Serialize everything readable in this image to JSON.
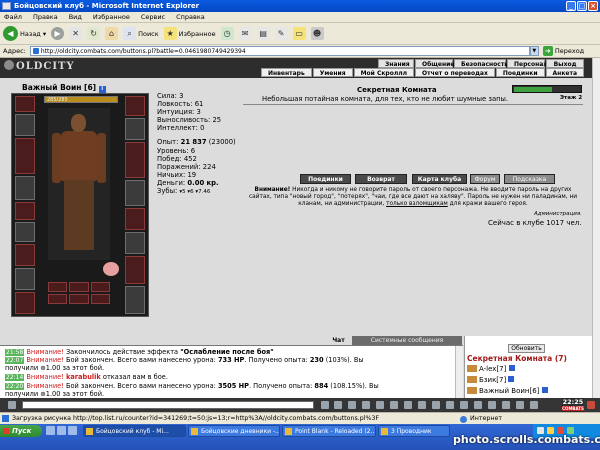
{
  "window": {
    "title": "Бойцовский клуб - Microsoft Internet Explorer"
  },
  "menu": [
    "Файл",
    "Правка",
    "Вид",
    "Избранное",
    "Сервис",
    "Справка"
  ],
  "toolbar": {
    "back": "Назад",
    "search": "Поиск",
    "favorites": "Избранное"
  },
  "address": {
    "label": "Адрес:",
    "url": "http://oldcity.combats.com/buttons.pl?battle=0.0461980749429394",
    "go": "Переход"
  },
  "game_nav": {
    "logo": "OLDCITY",
    "row1": [
      "Знания",
      "Общение",
      "Безопасность",
      "Персонаж",
      "Выход"
    ],
    "row2": [
      "Инвентарь",
      "Умения",
      "Мой Скроллл",
      "Отчет о переводах",
      "Поединки",
      "Анкета"
    ]
  },
  "character": {
    "name": "Важный Воин",
    "level": "[6]",
    "hp": "285/285",
    "hp_fraction": 1,
    "stats": [
      {
        "label": "Сила:",
        "value": "3"
      },
      {
        "label": "Ловкость:",
        "value": "61"
      },
      {
        "label": "Интуиция:",
        "value": "3"
      },
      {
        "label": "Выносливость:",
        "value": "25"
      },
      {
        "label": "Интеллект:",
        "value": "0"
      }
    ],
    "experience_label": "Опыт:",
    "experience": "21 837",
    "experience_next": "(23000)",
    "level_label": "Уровень:",
    "level_value": "6",
    "wins_label": "Побед:",
    "wins": "452",
    "losses_label": "Поражений:",
    "losses": "224",
    "draws_label": "Ничьих:",
    "draws": "19",
    "money_label": "Деньги:",
    "money": "0.00 кр.",
    "teeth_label": "Зубы:",
    "teeth": "▾5 ▾6 ▾7.46"
  },
  "room": {
    "title": "Секретная Комната",
    "description": "Небольшая потайная комната, для тех, кто не любит шумные запы.",
    "floor": "Этаж 2",
    "buttons": [
      "Поединки",
      "Возврат",
      "Карта клуба",
      "Форум",
      "Подсказка"
    ],
    "warning_bold": "Внимание!",
    "warning_text": "Никогда и никому не говорите пароль от своего персонажа. Не вводите пароль на других сайтах, типа \"новый город\", \"потерях\", \"чаи, где все дают на халяву\". Пароль не нужен ни паладинам, ни кланам, ни администрации,",
    "warning_link": "только взломщикам",
    "warning_tail": "для кражи вашего героя.",
    "admin": "Администрация.",
    "online": "Сейчас в клубе 1017 чел."
  },
  "chat": {
    "tab_chat": "Чат",
    "tab_system": "Системные сообщения",
    "lines": [
      {
        "time": "21:58",
        "warn": "Внимание!",
        "text": "Закончилось действие эффекта",
        "bold": "\"Ослабление после боя\""
      },
      {
        "time": "22:07",
        "warn": "Внимание!",
        "text": "Бой закончен. Всего вами нанесено урона:",
        "bold": "733 HP",
        "tail": ". Получено опыта:",
        "bold2": "230",
        "tail2": "(103%). Вы"
      },
      {
        "cont": "получили ⊛1.00 за этот бой."
      },
      {
        "time": "22:14",
        "warn": "Внимание!",
        "player": "karabulik",
        "text": "отказал вам в бое."
      },
      {
        "time": "22:20",
        "warn": "Внимание!",
        "text": "Бой закончен. Всего вами нанесено урона:",
        "bold": "3505 HP",
        "tail": ". Получено опыта:",
        "bold2": "884",
        "tail2": "(108.15%). Вы"
      },
      {
        "cont": "получили ⊛1.00 за этот бой."
      }
    ]
  },
  "online_panel": {
    "refresh": "Обновить",
    "room": "Секретная Комната (7)",
    "users": [
      "A-lex[7]",
      "Бзик[7]",
      "Важный Воин[6]"
    ]
  },
  "clock": {
    "time": "22:25",
    "brand": "COMBATS"
  },
  "status": {
    "text": "Загрузка рисунка http://top.list.ru/counter?id=341269;t=50;js=13;r=http%3A//oldcity.combats.com/buttons.pl%3F",
    "zone": "Интернет"
  },
  "taskbar": {
    "start": "Пуск",
    "tasks": [
      "Бойцовский клуб - Mi...",
      "Бойцовские дневники -...",
      "Point Blank - Reloaded (2...",
      "3 Проводник"
    ]
  },
  "watermark": "photo.scrolls.combats.com"
}
